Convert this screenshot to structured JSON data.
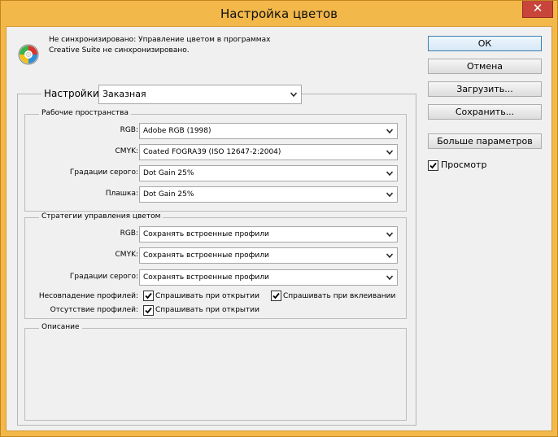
{
  "window": {
    "title": "Настройка цветов",
    "close_glyph": "✕"
  },
  "status": {
    "line1": "Не синхронизировано: Управление цветом в программах",
    "line2": "Creative Suite не синхронизировано."
  },
  "settings": {
    "label": "Настройки:",
    "value": "Заказная"
  },
  "working_spaces": {
    "legend": "Рабочие пространства",
    "rows": [
      {
        "label": "RGB:",
        "value": "Adobe RGB (1998)"
      },
      {
        "label": "CMYK:",
        "value": "Coated FOGRA39 (ISO 12647-2:2004)"
      },
      {
        "label": "Градации серого:",
        "value": "Dot Gain 25%"
      },
      {
        "label": "Плашка:",
        "value": "Dot Gain 25%"
      }
    ]
  },
  "policies": {
    "legend": "Стратегии управления цветом",
    "rows": [
      {
        "label": "RGB:",
        "value": "Сохранять встроенные профили"
      },
      {
        "label": "CMYK:",
        "value": "Сохранять встроенные профили"
      },
      {
        "label": "Градации серого:",
        "value": "Сохранять встроенные профили"
      }
    ],
    "mismatch_label": "Несовпадение профилей:",
    "mismatch_open": "Спрашивать при открытии",
    "mismatch_paste": "Спрашивать при вклеивании",
    "missing_label": "Отсутствие профилей:",
    "missing_open": "Спрашивать при открытии"
  },
  "description": {
    "legend": "Описание"
  },
  "buttons": {
    "ok": "ОК",
    "cancel": "Отмена",
    "load": "Загрузить...",
    "save": "Сохранить...",
    "more": "Больше параметров"
  },
  "preview": {
    "label": "Просмотр",
    "checked": true
  },
  "colors": {
    "accent": "#f3b84a",
    "close": "#c7453a",
    "panel": "#f0f0f0"
  }
}
